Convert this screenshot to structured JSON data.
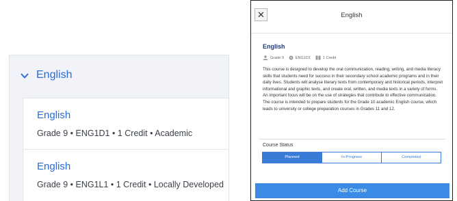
{
  "left_panel": {
    "section_title": "English",
    "courses": [
      {
        "name": "English",
        "meta": "Grade 9 • ENG1D1 • 1 Credit • Academic"
      },
      {
        "name": "English",
        "meta": "Grade 9 • ENG1L1 • 1 Credit • Locally Developed"
      }
    ]
  },
  "modal": {
    "close_label": "✕",
    "title": "English",
    "course_name": "English",
    "grade": "Grade 9",
    "code": "ENG1D1",
    "credit": "1 Credit",
    "description": "This course is designed to develop the oral communication, reading, writing, and media literacy skills that students need for success in their secondary school academic programs and in their daily lives. Students will analyse literary texts from contemporary and historical periods, interpret informational and graphic texts, and create oral, written, and media texts in a variety of forms. An important focus will be on the use of strategies that contribute to effective communication. The course is intended to prepare students for the Grade 10 academic English course, which leads to university or college preparation courses in Grades 11 and 12.",
    "status_label": "Course Status",
    "status_options": [
      "Planned",
      "In-Progress",
      "Completed"
    ],
    "selected_status": "Planned",
    "add_button": "Add Course"
  },
  "colors": {
    "accent": "#2b6bd6",
    "button": "#3b8be6",
    "panel_bg": "#f1f3f8",
    "heading": "#1f3a78"
  },
  "icons": [
    "chevron-down-icon",
    "close-icon",
    "person-icon",
    "disc-icon",
    "book-icon"
  ]
}
